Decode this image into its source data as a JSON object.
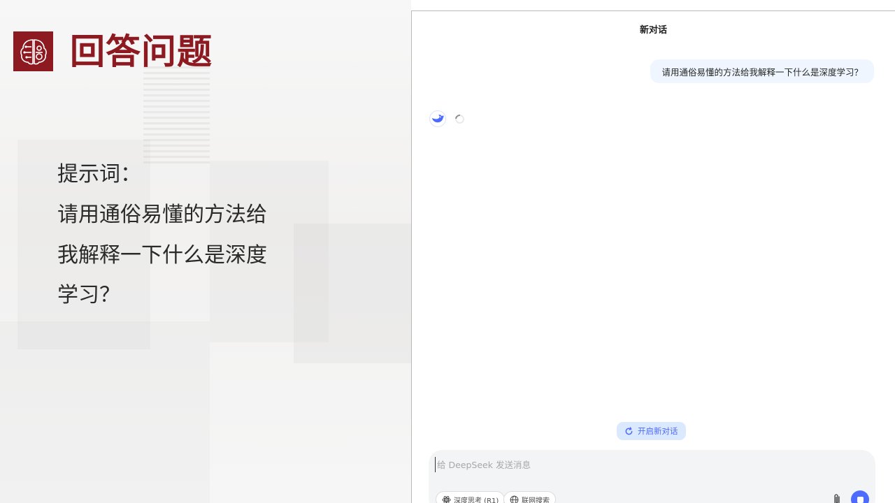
{
  "slide": {
    "title": "回答问题",
    "prompt_label": "提示词：",
    "prompt_lines": [
      "请用通俗易懂的方法给",
      "我解释一下什么是深度",
      "学习？"
    ]
  },
  "chat": {
    "header_title": "新对话",
    "user_message": "请用通俗易懂的方法给我解释一下什么是深度学习？",
    "bot_state": "loading",
    "new_chat_label": "开启新对话",
    "input": {
      "value": "",
      "placeholder": "给 DeepSeek 发送消息"
    },
    "deep_think_label": "深度思考 (R1)",
    "web_search_label": "联网搜索"
  },
  "icons": {
    "logo": "brain-circuit-icon",
    "bot_avatar": "whale-icon",
    "new_chat": "refresh-icon",
    "deep_think": "atom-icon",
    "web_search": "globe-icon",
    "attach": "paperclip-icon",
    "send": "stop-icon"
  },
  "colors": {
    "brand_red": "#8e1a21",
    "accent_blue": "#4d6bfe",
    "user_bubble": "#eff6ff"
  }
}
